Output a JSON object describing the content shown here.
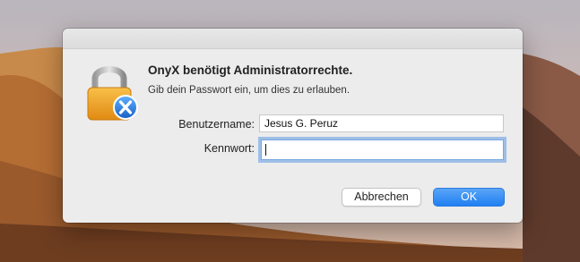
{
  "dialog": {
    "title": "OnyX benötigt Administratorrechte.",
    "message": "Gib dein Passwort ein, um dies zu erlauben.",
    "username_label": "Benutzername:",
    "username_value": "Jesus G. Peruz",
    "password_label": "Kennwort:",
    "password_value": "",
    "cancel_label": "Abbrechen",
    "ok_label": "OK",
    "lock_icon": "padlock-with-onyx-badge-icon",
    "colors": {
      "ok_button": "#1f7ff2",
      "dialog_bg": "#ececec",
      "focus_ring": "#5f9ae4"
    }
  }
}
